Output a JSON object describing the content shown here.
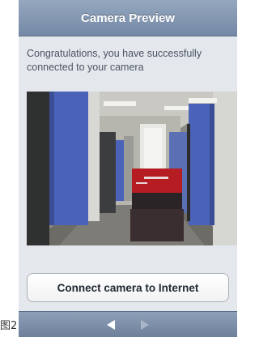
{
  "caption": "图2",
  "navbar": {
    "title": "Camera Preview"
  },
  "message": "Congratulations, you have successfully connected to your camera",
  "preview": {
    "label": "camera-preview-image"
  },
  "connect_button": {
    "label": "Connect camera to Internet"
  },
  "toolbar": {
    "back_icon": "left-arrow-icon",
    "forward_icon": "right-arrow-icon"
  },
  "colors": {
    "navbar": "#7f93ae",
    "background": "#e4e7ec",
    "text": "#4b5565"
  }
}
